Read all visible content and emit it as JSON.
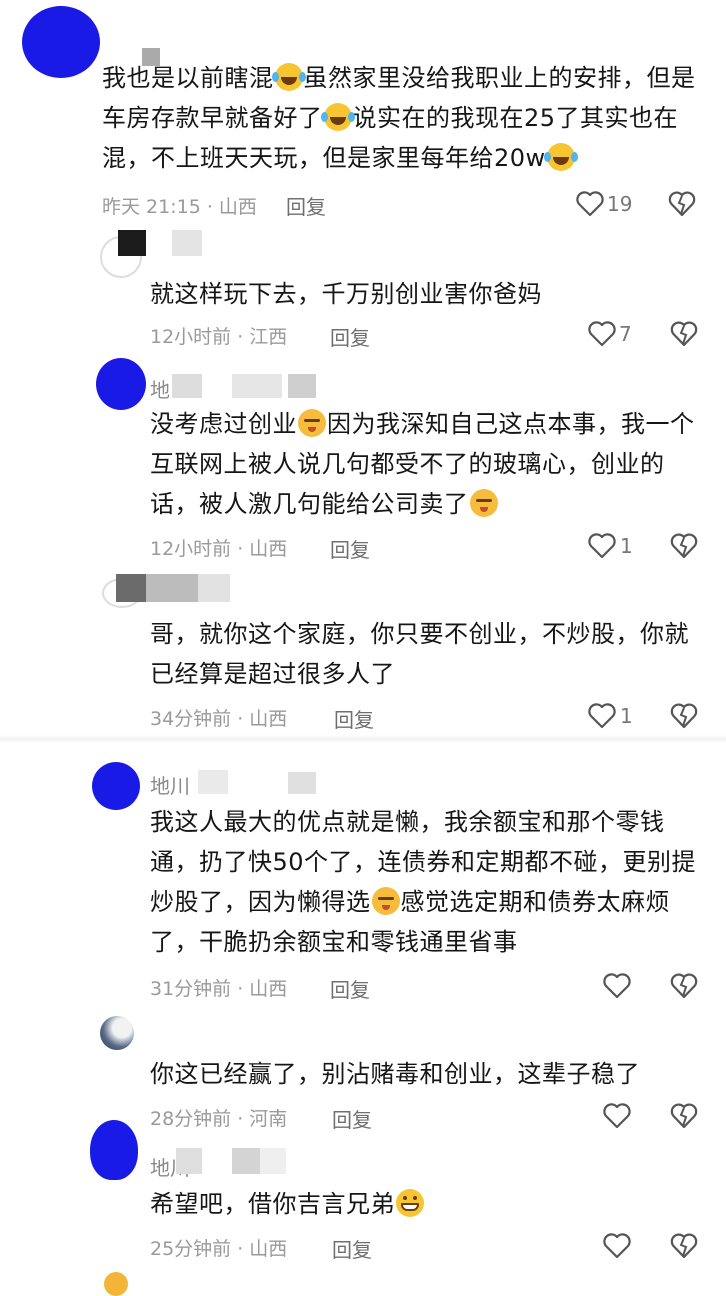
{
  "comments": [
    {
      "name": "",
      "text_parts": [
        "我也是以前瞎混",
        "虽然家里没给我职业上的安排，但是车房存款早就备好了",
        "说实在的我现在25了其实也在混，不上班天天玩，但是家里每年给20w"
      ],
      "time": "昨天 21:15 · 山西",
      "reply": "回复",
      "likes": "19"
    },
    {
      "name": "",
      "text": "就这样玩下去，千万别创业害你爸妈",
      "time": "12小时前 · 江西",
      "reply": "回复",
      "likes": "7"
    },
    {
      "name": "地",
      "text_parts": [
        "没考虑过创业",
        "因为我深知自己这点本事，我一个互联网上被人说几句都受不了的玻璃心，创业的话，被人激几句能给公司卖了"
      ],
      "time": "12小时前 · 山西",
      "reply": "回复",
      "likes": "1"
    },
    {
      "name": "",
      "text": "哥，就你这个家庭，你只要不创业，不炒股，你就已经算是超过很多人了",
      "time": "34分钟前 · 山西",
      "reply": "回复",
      "likes": "1"
    },
    {
      "name": "地川",
      "text_parts": [
        "我这人最大的优点就是懒，我余额宝和那个零钱通，扔了快50个了，连债券和定期都不碰，更别提炒股了，因为懒得选",
        "感觉选定期和债券太麻烦了，干脆扔余额宝和零钱通里省事"
      ],
      "time": "31分钟前 · 山西",
      "reply": "回复",
      "likes": ""
    },
    {
      "name": "",
      "text": "你这已经赢了，别沾赌毒和创业，这辈子稳了",
      "time": "28分钟前 · 河南",
      "reply": "回复",
      "likes": ""
    },
    {
      "name": "地川",
      "text_parts": [
        "希望吧，借你吉言兄弟"
      ],
      "time": "25分钟前 · 山西",
      "reply": "回复",
      "likes": ""
    }
  ],
  "icons": {
    "like": "heart-outline-icon",
    "dislike": "broken-heart-icon",
    "emoji_laugh": "tears-of-joy-emoji",
    "emoji_smug": "smirk-emoji",
    "emoji_grin": "grin-emoji"
  },
  "colors": {
    "avatar_blue": "#1515e8",
    "text": "#161616",
    "meta": "#9a9a9a"
  }
}
